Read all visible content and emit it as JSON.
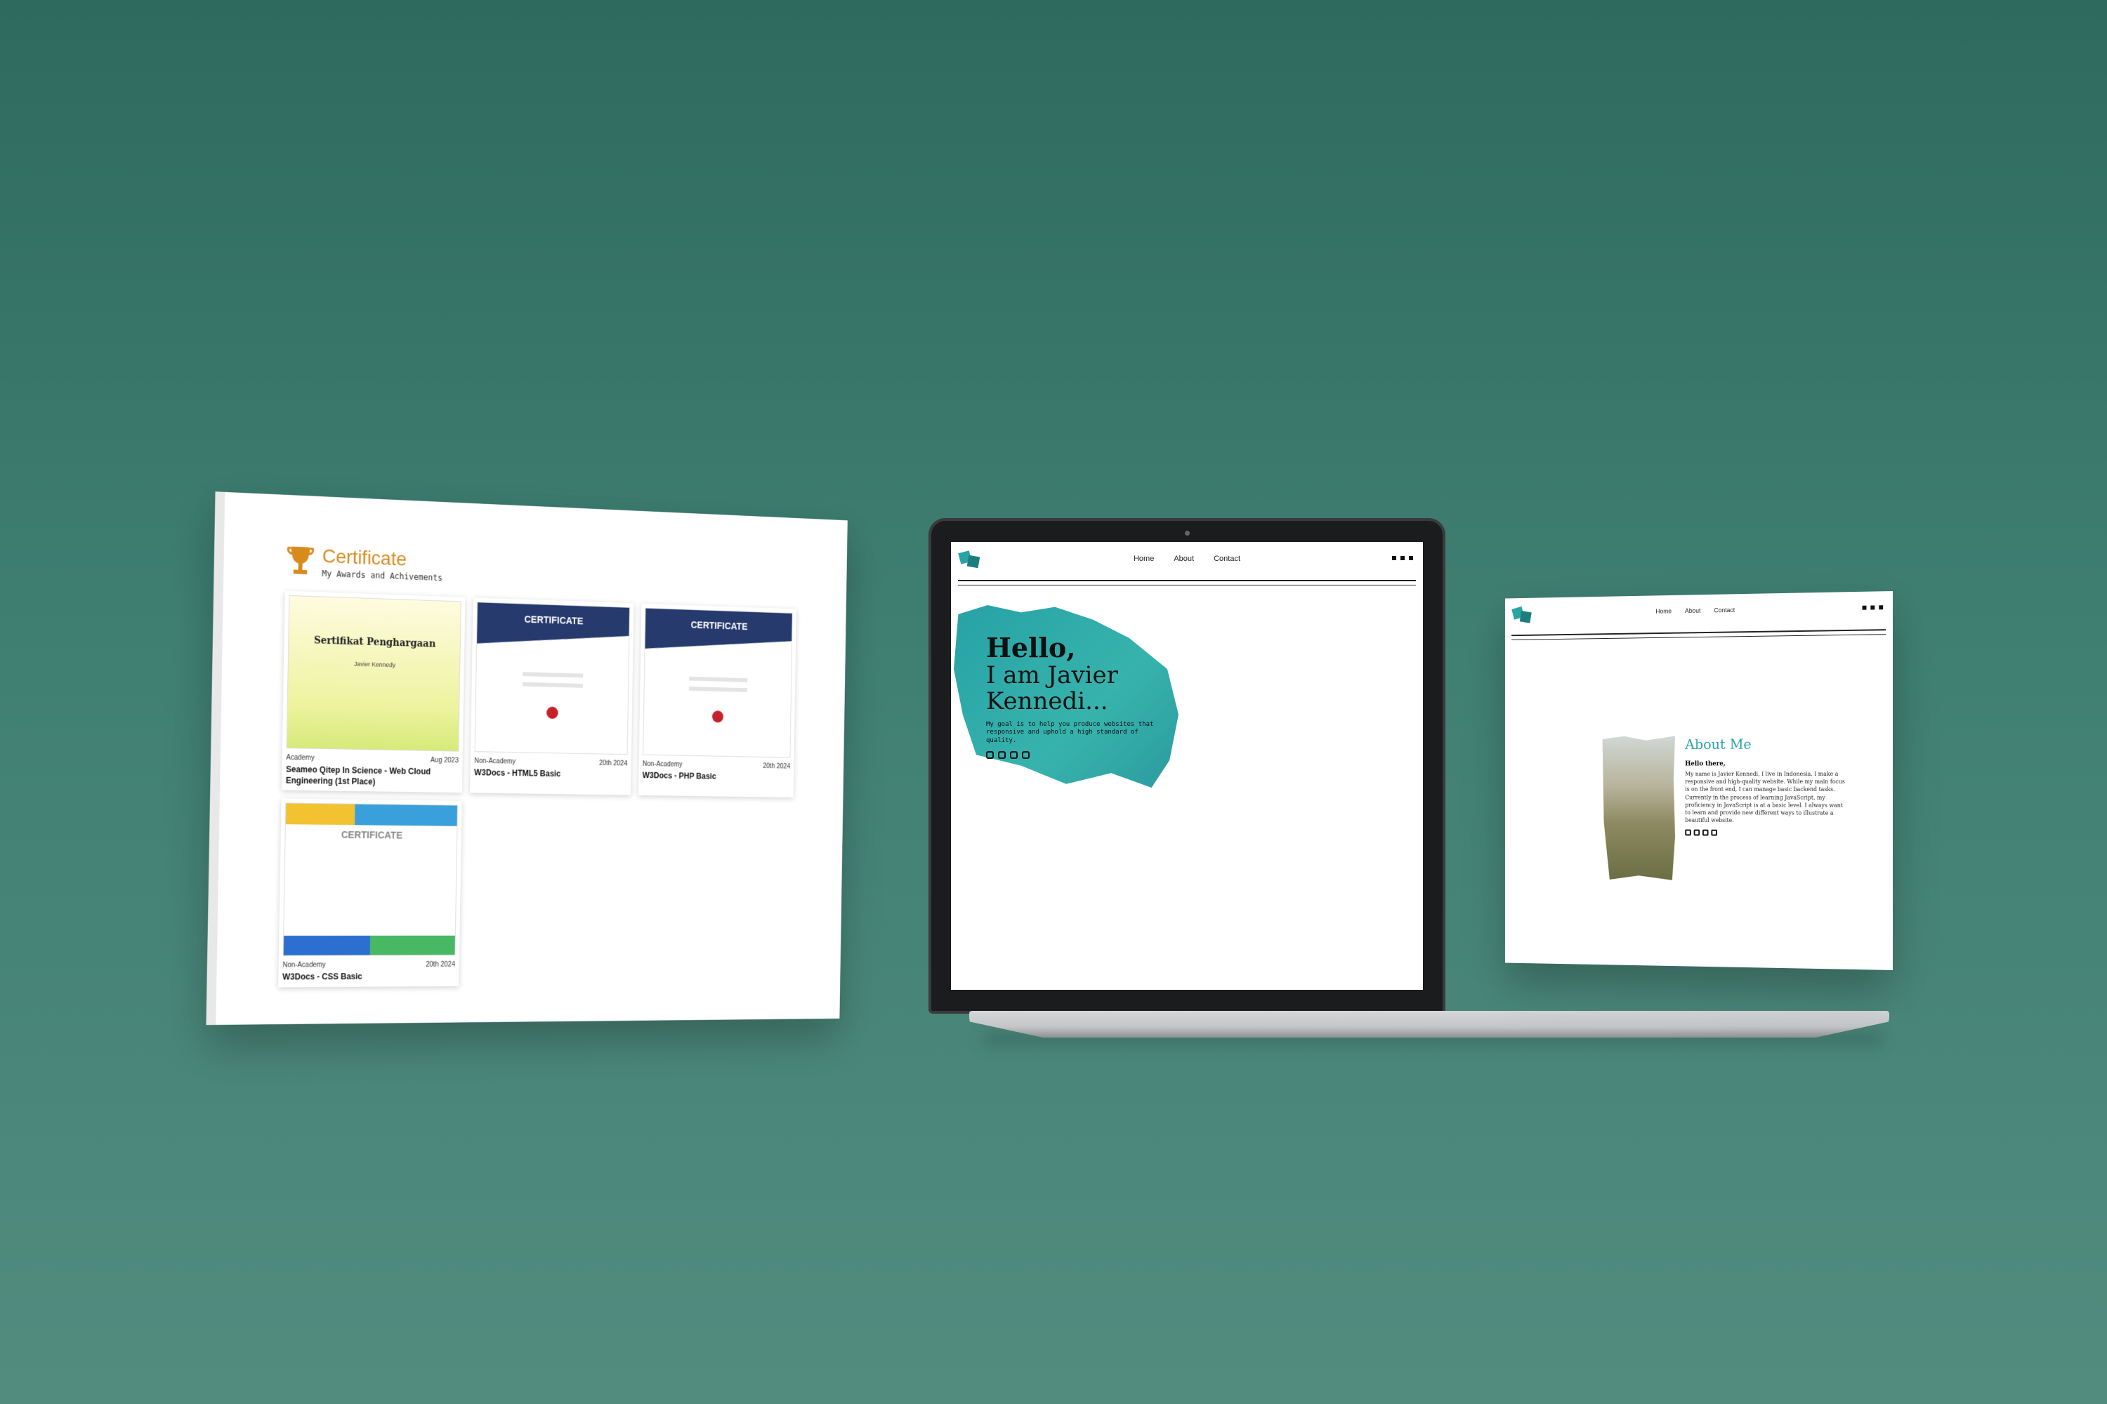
{
  "colors": {
    "background": "#3a786b",
    "accent_orange": "#d98a1c",
    "accent_teal": "#2aa3a4"
  },
  "certificate_page": {
    "title": "Certificate",
    "subtitle": "My Awards and Achivements",
    "trophy_icon": "trophy-icon",
    "cards": [
      {
        "thumb_title": "Sertifikat Penghargaan",
        "thumb_name": "Javier Kennedy",
        "category": "Academy",
        "date": "Aug 2023",
        "name": "Seameo Qitep In Science - Web Cloud Engineering (1st Place)"
      },
      {
        "thumb_title": "CERTIFICATE",
        "category": "Non-Academy",
        "date": "20th 2024",
        "name": "W3Docs - HTML5 Basic"
      },
      {
        "thumb_title": "CERTIFICATE",
        "category": "Non-Academy",
        "date": "20th 2024",
        "name": "W3Docs - PHP Basic"
      },
      {
        "thumb_title": "CERTIFICATE",
        "category": "Non-Academy",
        "date": "20th 2024",
        "name": "W3Docs - CSS Basic"
      }
    ]
  },
  "home_page": {
    "nav": [
      "Home",
      "About",
      "Contact"
    ],
    "hello": "Hello,",
    "name_line1": "I am Javier",
    "name_line2": "Kennedi...",
    "description": "My goal is to help you produce websites that responsive and uphold a high standard of quality.",
    "socials": [
      "instagram-icon",
      "github-icon",
      "youtube-icon",
      "twitter-icon"
    ]
  },
  "about_page": {
    "nav": [
      "Home",
      "About",
      "Contact"
    ],
    "title": "About Me",
    "greeting": "Hello there,",
    "body": "My name is Javier Kennedi, I live in Indonesia. I make a responsive and high-quality website. While my main focus is on the front end, I can manage basic backend tasks. Currently in the process of learning JavaScript, my proficiency in JavaScript is at a basic level. I always want to learn and provide new different ways to illustrate a beautiful website.",
    "socials": [
      "instagram-icon",
      "github-icon",
      "youtube-icon",
      "twitter-icon"
    ]
  }
}
